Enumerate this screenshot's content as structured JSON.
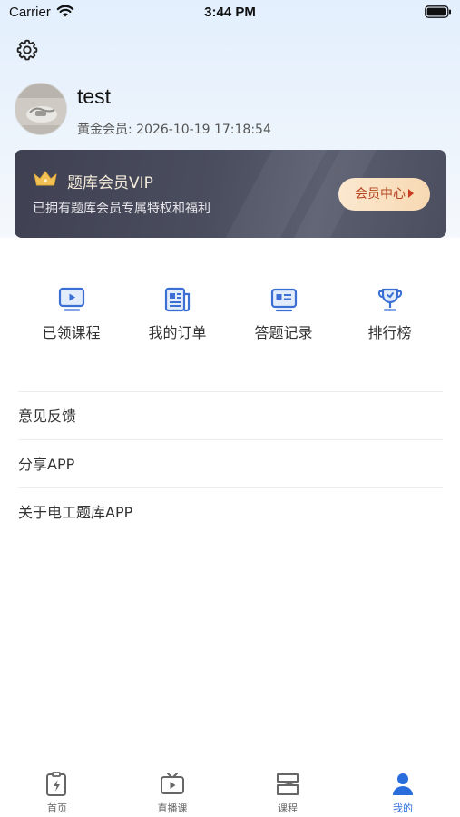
{
  "status_bar": {
    "carrier": "Carrier",
    "time": "3:44 PM"
  },
  "profile": {
    "username": "test",
    "membership_expiry": "黄金会员: 2026-10-19 17:18:54"
  },
  "vip_card": {
    "title": "题库会员VIP",
    "description": "已拥有题库会员专属特权和福利",
    "button_label": "会员中心"
  },
  "quick_actions": [
    {
      "label": "已领课程",
      "icon": "play-video-icon"
    },
    {
      "label": "我的订单",
      "icon": "order-document-icon"
    },
    {
      "label": "答题记录",
      "icon": "answer-record-icon"
    },
    {
      "label": "排行榜",
      "icon": "trophy-icon"
    }
  ],
  "menu": [
    {
      "label": "意见反馈"
    },
    {
      "label": "分享APP"
    },
    {
      "label": "关于电工题库APP"
    }
  ],
  "tabs": [
    {
      "label": "首页",
      "icon": "home-lightning-icon",
      "active": false
    },
    {
      "label": "直播课",
      "icon": "live-tv-icon",
      "active": false
    },
    {
      "label": "课程",
      "icon": "courses-icon",
      "active": false
    },
    {
      "label": "我的",
      "icon": "profile-icon",
      "active": true
    }
  ],
  "colors": {
    "accent": "#2a6ddc",
    "icon_blue": "#3b6fd4",
    "vip_button_text": "#b4451f"
  }
}
